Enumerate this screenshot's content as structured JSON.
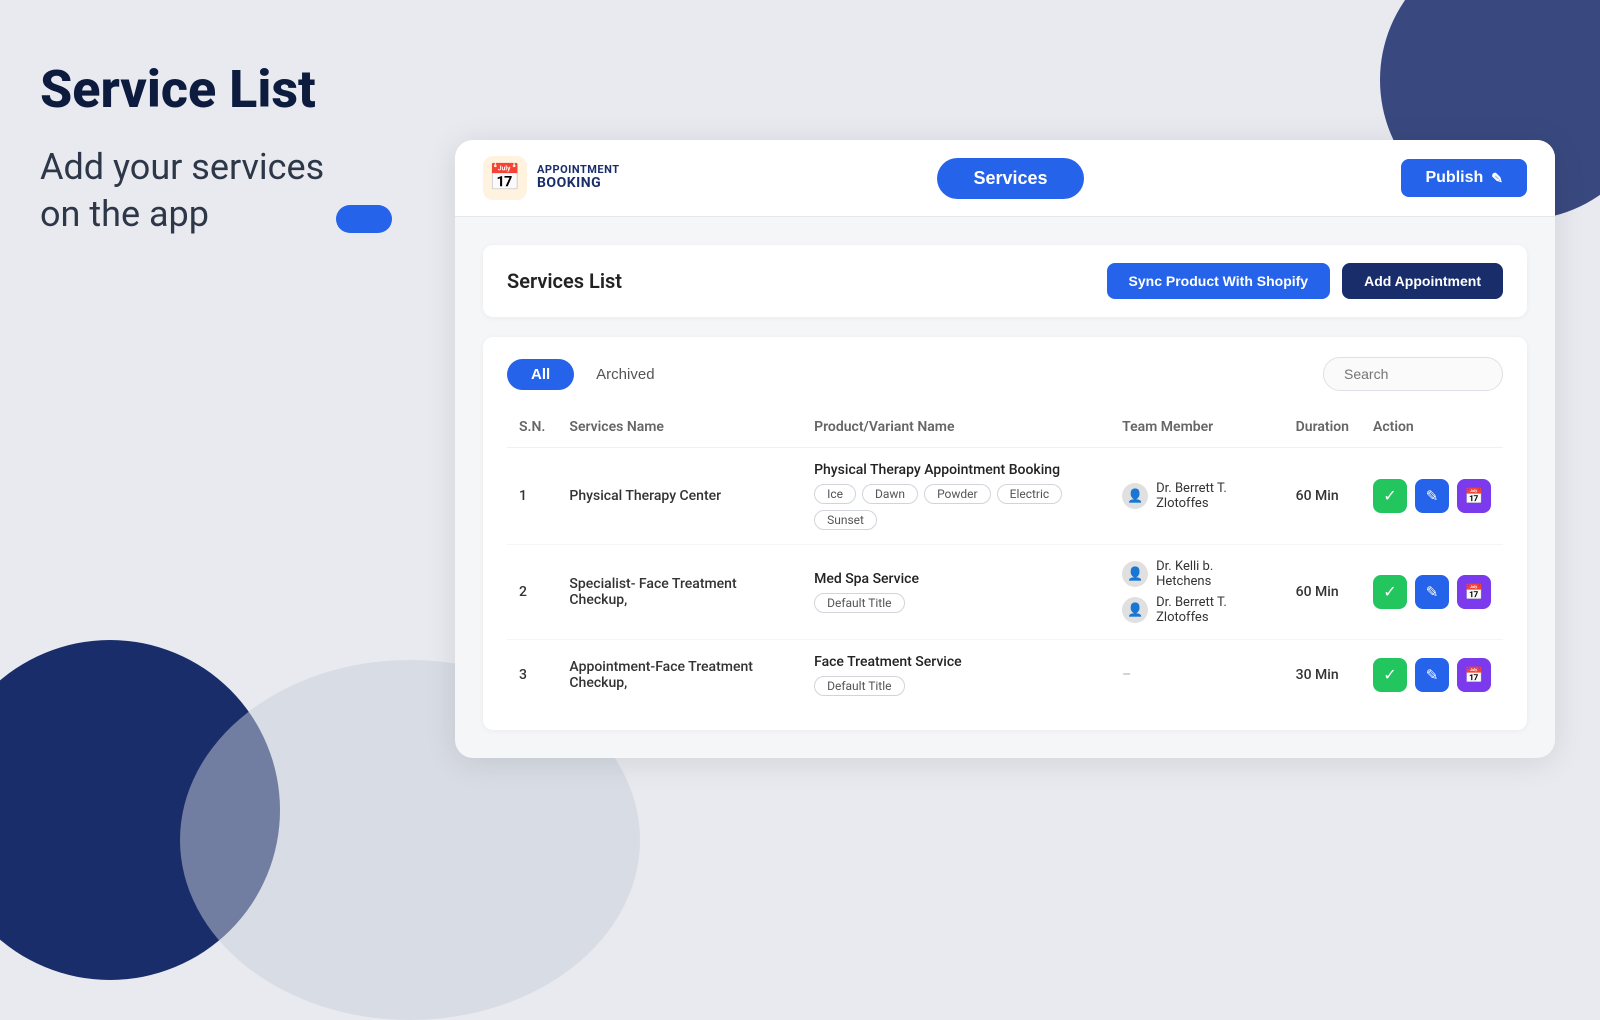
{
  "background": {
    "color": "#e8eaf0"
  },
  "left_panel": {
    "main_title": "Service List",
    "subtitle_line1": "Add your services",
    "subtitle_line2": "on the app"
  },
  "nav": {
    "logo_icon": "📅",
    "logo_top": "APPOINTMENT",
    "logo_bottom": "BOOKING",
    "services_label": "Services",
    "publish_label": "Publish",
    "publish_icon": "✏️"
  },
  "services_header": {
    "title": "Services List",
    "sync_btn": "Sync Product With Shopify",
    "add_btn": "Add Appointment"
  },
  "filters": {
    "tab_all": "All",
    "tab_archived": "Archived",
    "search_placeholder": "Search"
  },
  "table": {
    "columns": [
      "S.N.",
      "Services Name",
      "Product/Variant Name",
      "Team Member",
      "Duration",
      "Action"
    ],
    "rows": [
      {
        "sn": "1",
        "service_name": "Physical Therapy Center",
        "product_name": "Physical Therapy Appointment Booking",
        "tags": [
          "Ice",
          "Dawn",
          "Powder",
          "Electric",
          "Sunset"
        ],
        "team_members": [
          "Dr. Berrett T. Zlotoffes"
        ],
        "duration": "60 Min"
      },
      {
        "sn": "2",
        "service_name": "Specialist- Face Treatment Checkup,",
        "product_name": "Med Spa Service",
        "tags": [
          "Default Title"
        ],
        "team_members": [
          "Dr. Kelli b. Hetchens",
          "Dr. Berrett T. Zlotoffes"
        ],
        "duration": "60 Min"
      },
      {
        "sn": "3",
        "service_name": "Appointment-Face Treatment Checkup,",
        "product_name": "Face Treatment Service",
        "tags": [
          "Default Title"
        ],
        "team_members": [],
        "duration": "30 Min"
      }
    ]
  }
}
